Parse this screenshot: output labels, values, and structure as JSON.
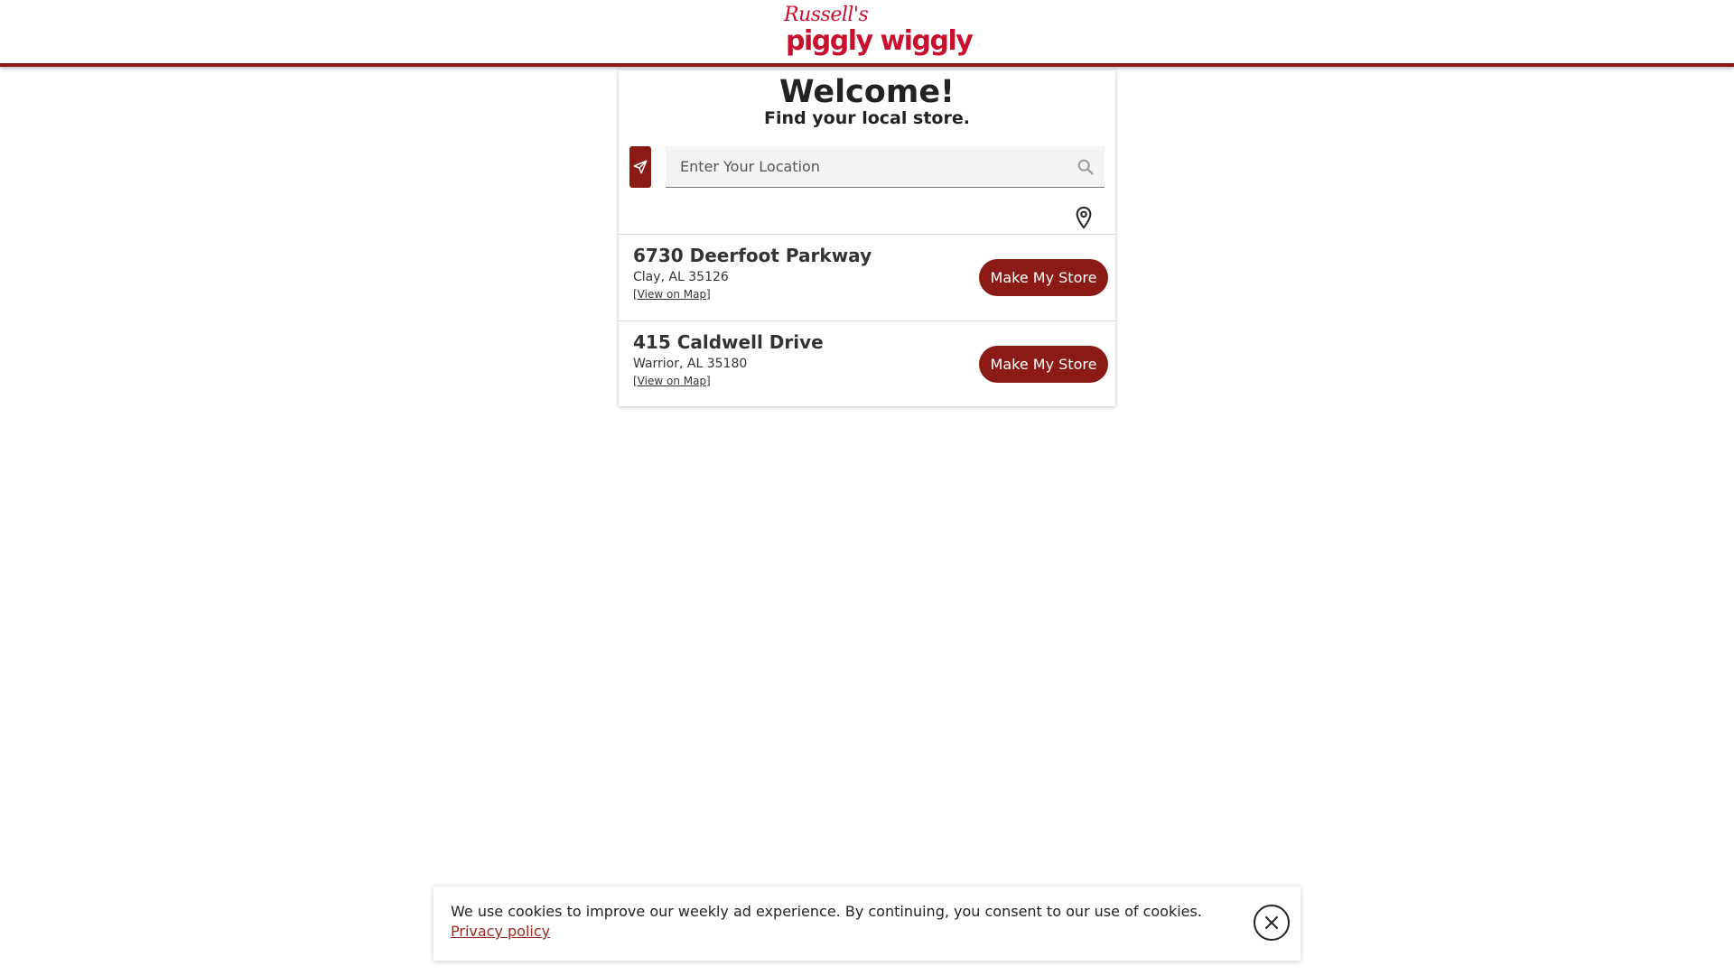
{
  "header": {
    "logo_script": "Russell's",
    "logo_main": "piggly wiggly",
    "brand_color": "#c8102e",
    "bar_color": "#8b1a14"
  },
  "finder": {
    "title": "Welcome!",
    "subtitle": "Find your local store.",
    "search_placeholder": "Enter Your Location",
    "locate_icon": "navigation-arrow-icon",
    "search_icon": "search-icon",
    "pin_icon": "map-pin-icon"
  },
  "stores": [
    {
      "name": "6730 Deerfoot Parkway",
      "city": "Clay, AL 35126",
      "map_link": "[View on Map]",
      "button": "Make My Store"
    },
    {
      "name": "415 Caldwell Drive",
      "city": "Warrior, AL 35180",
      "map_link": "[View on Map]",
      "button": "Make My Store"
    }
  ],
  "cookie": {
    "message": "We use cookies to improve our weekly ad experience. By continuing, you consent to our use of cookies.",
    "link": "Privacy policy",
    "close_icon": "close-icon"
  }
}
